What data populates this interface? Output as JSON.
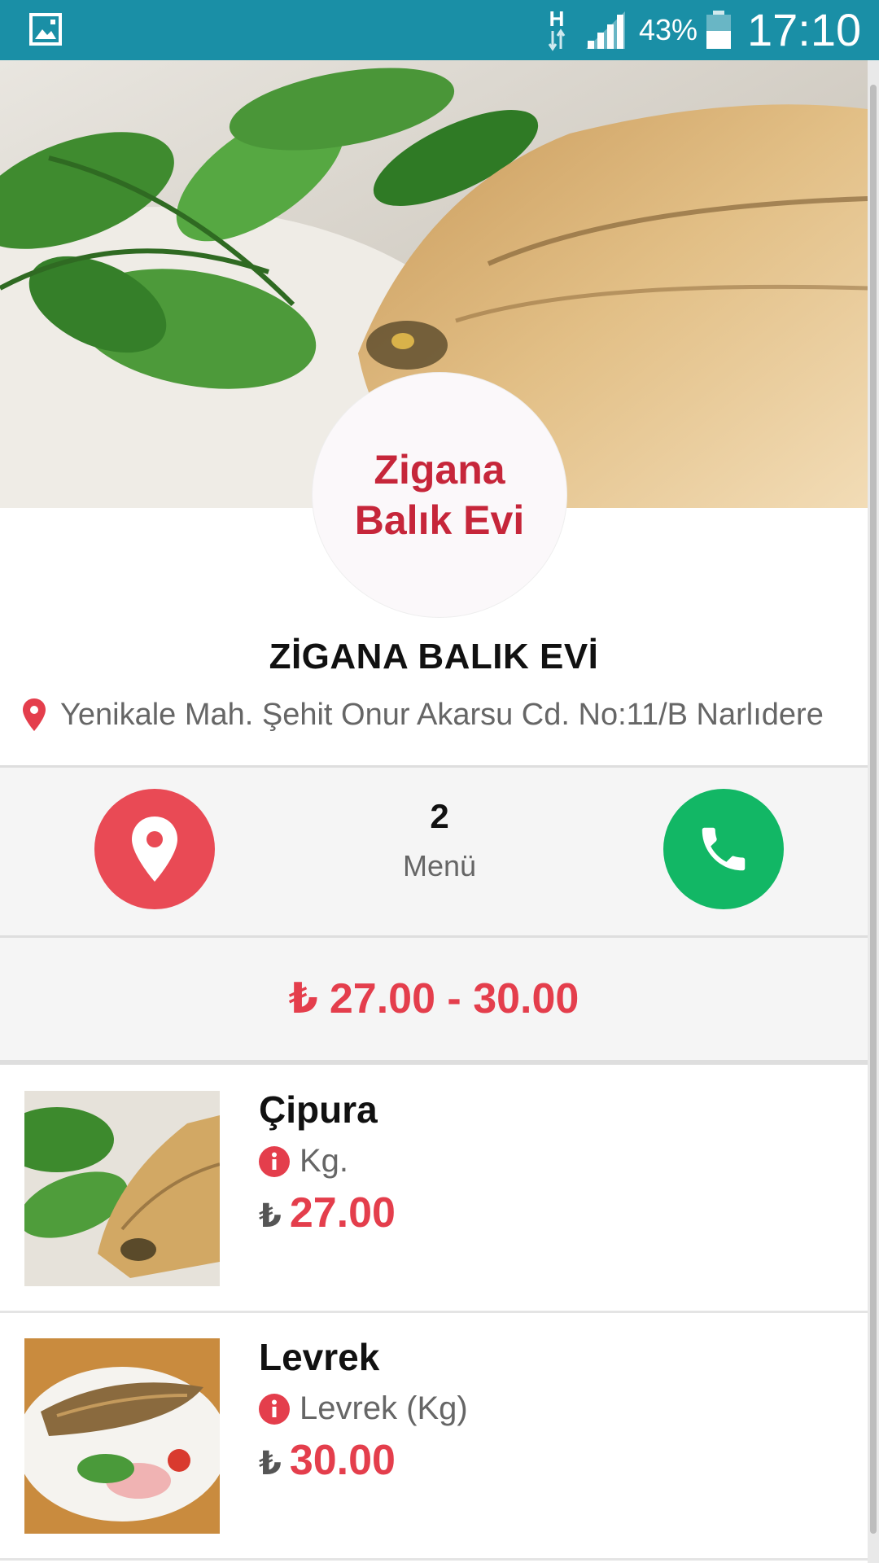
{
  "status_bar": {
    "network_type": "H",
    "battery_percent": "43%",
    "time": "17:10",
    "icons": [
      "gallery-icon",
      "network-h-icon",
      "signal-icon",
      "battery-icon"
    ]
  },
  "restaurant": {
    "logo_line1": "Zigana",
    "logo_line2": "Balık Evi",
    "name": "ZİGANA BALIK EVİ",
    "address": "Yenikale Mah. Şehit Onur Akarsu Cd. No:11/B Narlıdere"
  },
  "actions": {
    "menu_count": "2",
    "menu_label": "Menü"
  },
  "price_range": {
    "currency": "₺",
    "text": "27.00 - 30.00"
  },
  "menu_items": [
    {
      "name": "Çipura",
      "description": "Kg.",
      "currency": "₺",
      "price": "27.00"
    },
    {
      "name": "Levrek",
      "description": "Levrek (Kg)",
      "currency": "₺",
      "price": "30.00"
    }
  ],
  "colors": {
    "status_bar": "#1a8fa6",
    "accent_red": "#e43e4c",
    "call_green": "#12b765"
  }
}
